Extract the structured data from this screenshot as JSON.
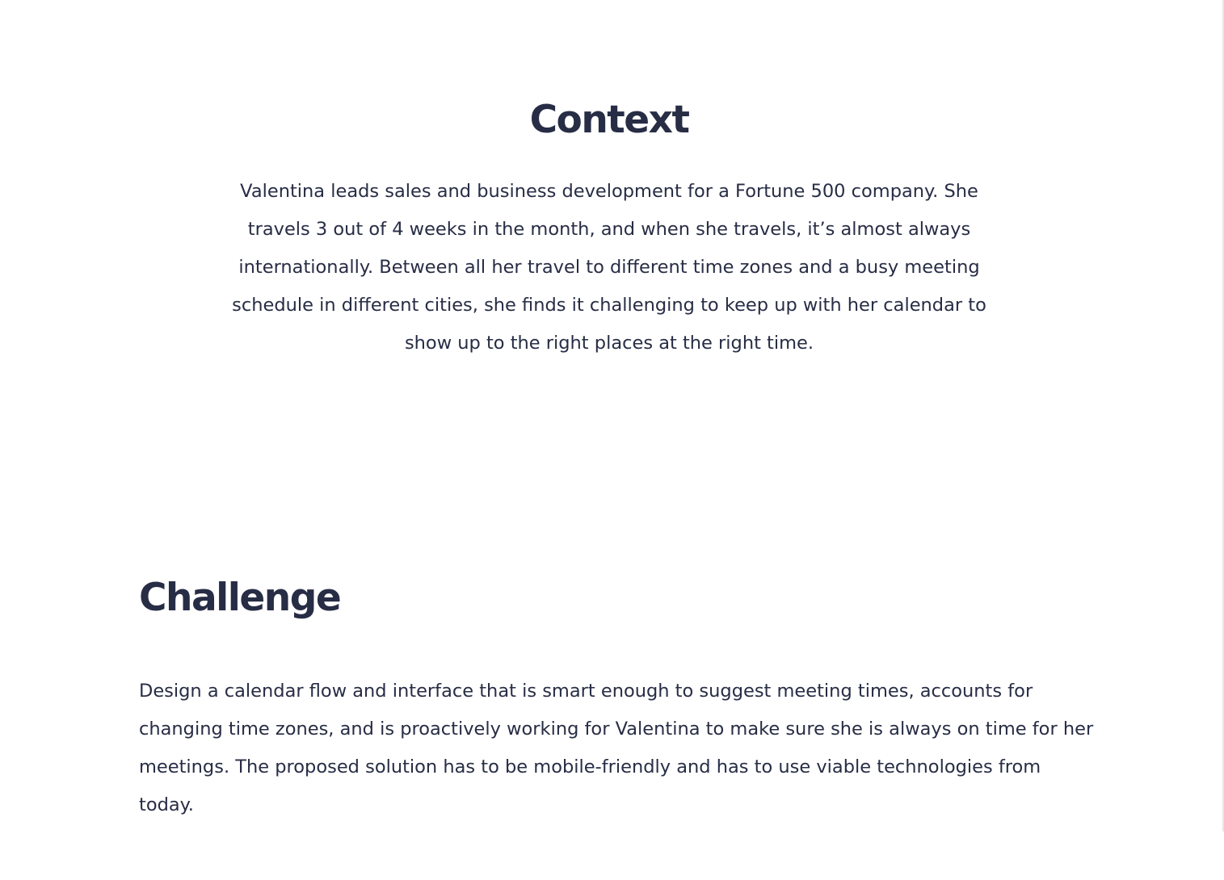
{
  "context": {
    "title": "Context",
    "body": "Valentina leads sales and business development for a Fortune 500 company. She travels 3 out of 4 weeks in the month, and when she travels, it’s almost always internationally. Between all her travel to different time zones and a busy meeting schedule in different cities, she finds it challenging to keep up with her calendar to show up to the right places at the right time."
  },
  "challenge": {
    "title": "Challenge",
    "body": "Design a calendar flow and interface that is smart enough to suggest meeting times, accounts for changing time zones, and is proactively working for Valentina to make sure she is always on time for her meetings. The proposed solution has to be mobile-friendly and has to use viable technologies from today."
  },
  "colors": {
    "text": "#272d45",
    "background": "#ffffff"
  }
}
